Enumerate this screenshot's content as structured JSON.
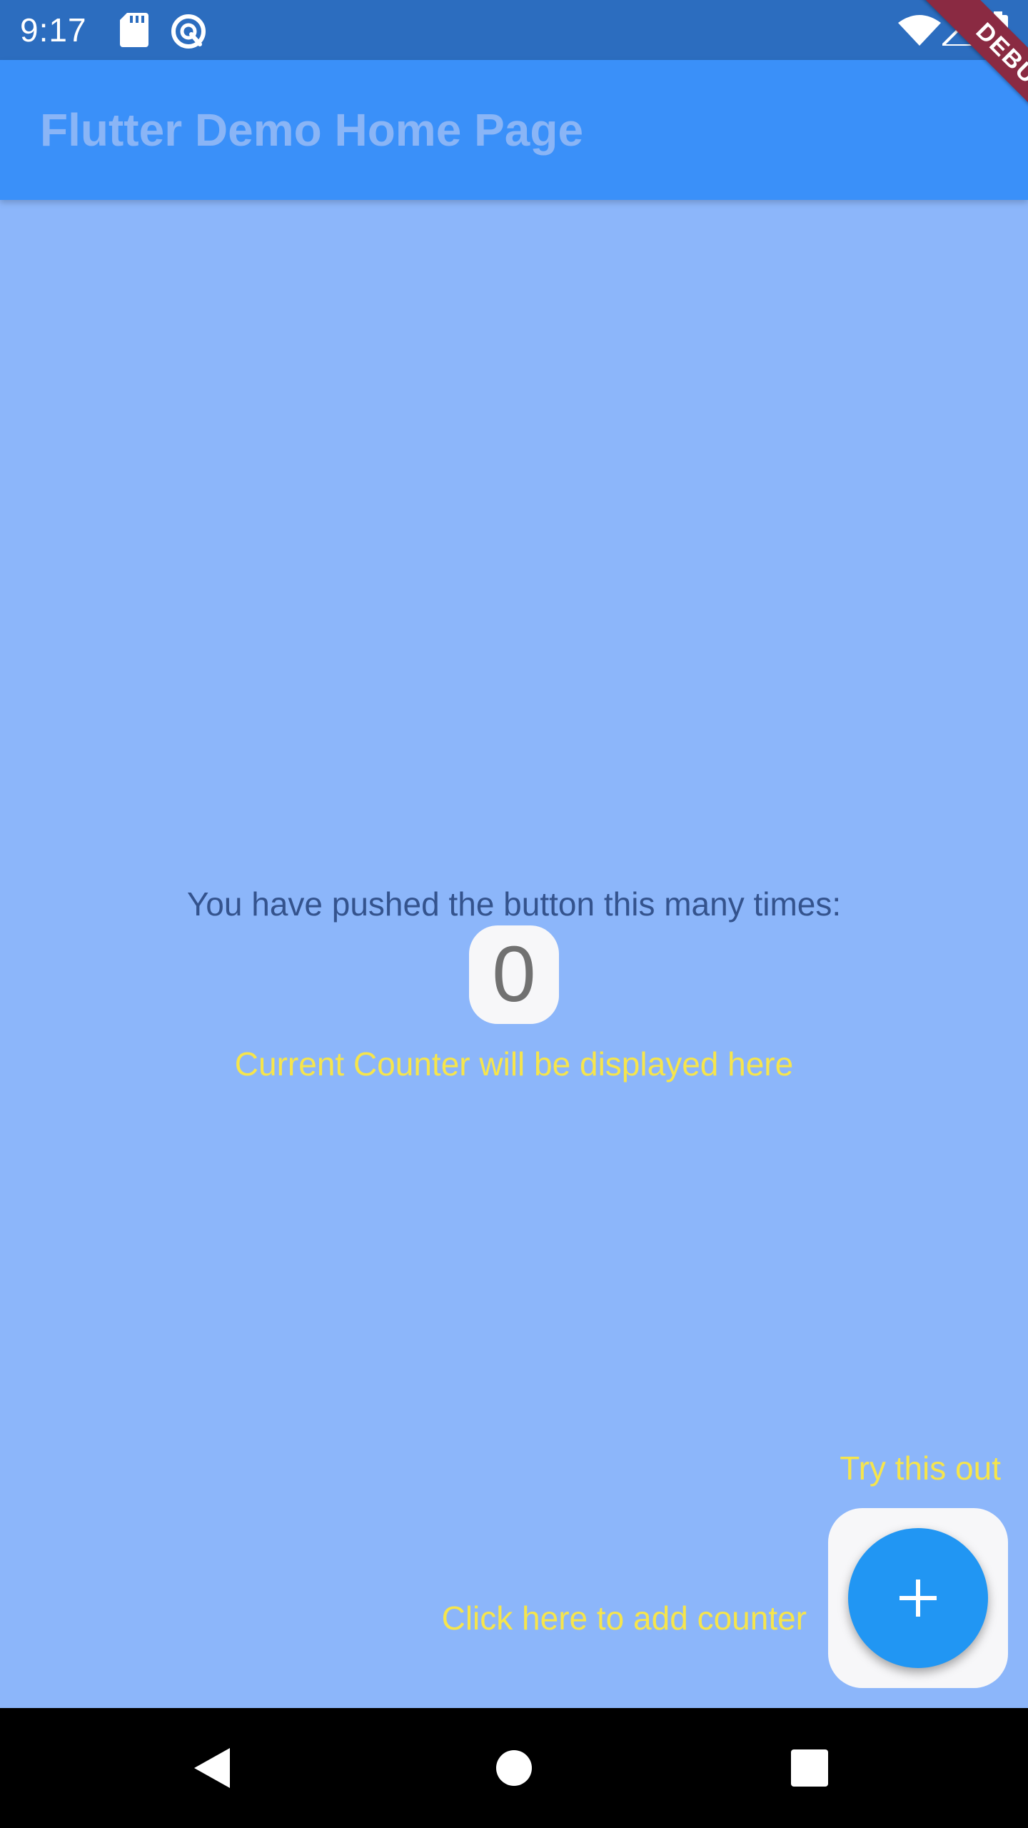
{
  "status_bar": {
    "time": "9:17",
    "left_icons": [
      "sd-card-icon",
      "sync-icon"
    ],
    "right_icons": [
      "wifi-icon",
      "signal-icon",
      "battery-icon"
    ]
  },
  "app_bar": {
    "title": "Flutter Demo Home Page",
    "debug_label": "DEBUG"
  },
  "body": {
    "pushed_label": "You have pushed the button this many times:",
    "counter_value": "0",
    "counter_hint": "Current Counter will be displayed here"
  },
  "fab": {
    "try_label": "Try this out",
    "add_hint": "Click here to add counter",
    "icon": "plus-icon"
  },
  "nav_bar": {
    "buttons": [
      "back-icon",
      "home-icon",
      "recents-icon"
    ]
  },
  "colors": {
    "background": "#8cb6fa",
    "app_bar": "#3a90f9",
    "status_bar": "#2c6dbf",
    "fab": "#2196f3",
    "hint_text": "#f6e54c",
    "debug_ribbon": "#8a2a42"
  }
}
